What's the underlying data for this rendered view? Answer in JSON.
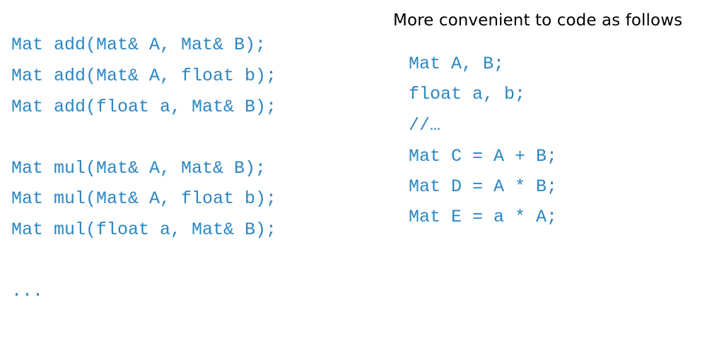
{
  "heading": "More convenient to code as follows",
  "left_code": {
    "add_lines": [
      "Mat add(Mat& A, Mat& B);",
      "Mat add(Mat& A, float b);",
      "Mat add(float a, Mat& B);"
    ],
    "mul_lines": [
      "Mat mul(Mat& A, Mat& B);",
      "Mat mul(Mat& A, float b);",
      "Mat mul(float a, Mat& B);"
    ],
    "ellipsis": "..."
  },
  "right_code": {
    "lines": [
      "Mat A, B;",
      "float a, b;",
      "//…",
      "Mat C = A + B;",
      "Mat D = A * B;",
      "Mat E = a * A;"
    ]
  },
  "colors": {
    "code": "#2a86c4",
    "heading": "#000000",
    "background": "#ffffff"
  }
}
